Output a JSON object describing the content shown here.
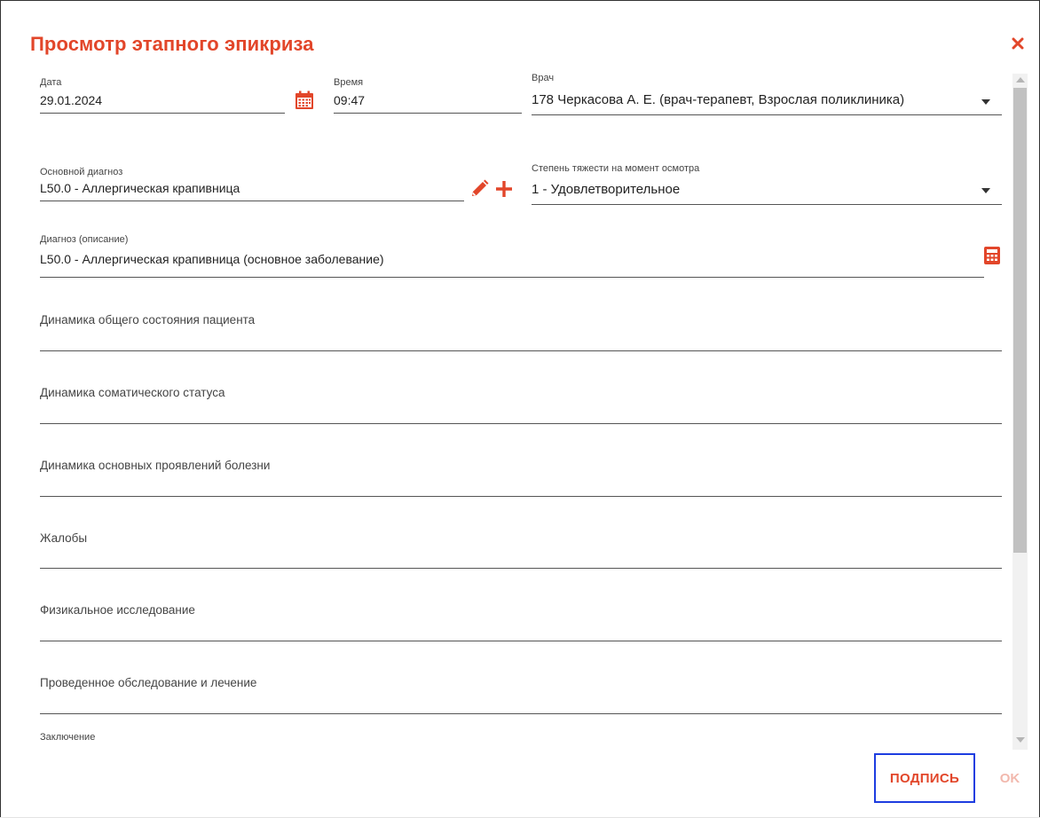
{
  "dialog": {
    "title": "Просмотр этапного эпикриза"
  },
  "fields": {
    "date": {
      "label": "Дата",
      "value": "29.01.2024"
    },
    "time": {
      "label": "Время",
      "value": "09:47"
    },
    "doctor": {
      "label": "Врач",
      "value": "178 Черкасова А. Е.  (врач-терапевт, Взрослая поликлиника)"
    },
    "main_diagnosis": {
      "label": "Основной диагноз",
      "value": "L50.0 - Аллергическая крапивница"
    },
    "severity": {
      "label": "Степень тяжести на момент осмотра",
      "value": "1 - Удовлетворительное"
    },
    "diagnosis_desc": {
      "label": "Диагноз (описание)",
      "value": "L50.0 - Аллергическая крапивница (основное заболевание)"
    },
    "general_state": {
      "label": "Динамика общего состояния пациента",
      "value": ""
    },
    "somatic_status": {
      "label": "Динамика соматического статуса",
      "value": ""
    },
    "disease_manifest": {
      "label": "Динамика основных проявлений болезни",
      "value": ""
    },
    "complaints": {
      "label": "Жалобы",
      "value": ""
    },
    "physical_exam": {
      "label": "Физикальное исследование",
      "value": ""
    },
    "exam_treatment": {
      "label": "Проведенное обследование и лечение",
      "value": ""
    },
    "conclusion": {
      "label": "Заключение",
      "value": ""
    }
  },
  "buttons": {
    "sign": "ПОДПИСЬ",
    "ok": "OK"
  },
  "colors": {
    "accent": "#e2462a",
    "focus_border": "#1d3de0",
    "ok_disabled": "#f2b8ad"
  },
  "icons": [
    "close-icon",
    "calendar-icon",
    "pencil-icon",
    "plus-icon",
    "calculator-icon",
    "chevron-down-icon"
  ]
}
